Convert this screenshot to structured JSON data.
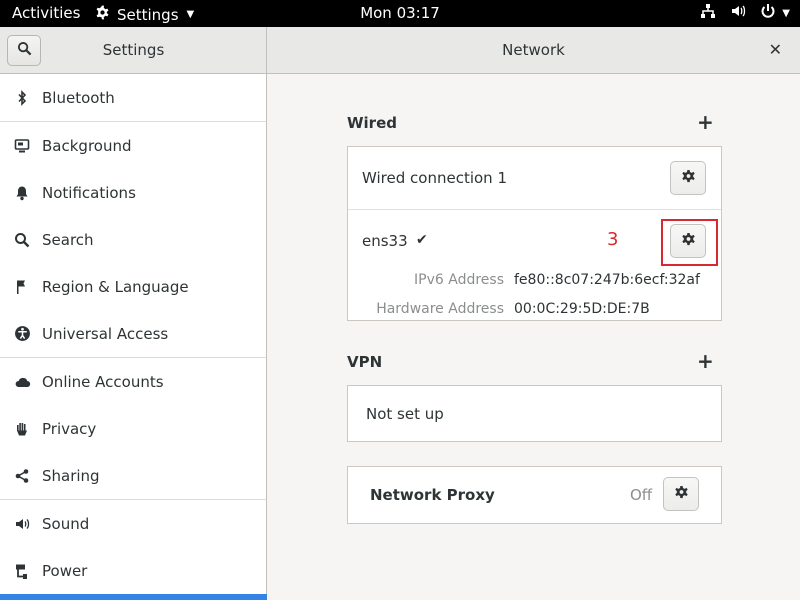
{
  "topbar": {
    "activities": "Activities",
    "app_name": "Settings",
    "clock": "Mon 03:17"
  },
  "headerbar": {
    "left_title": "Settings",
    "right_title": "Network"
  },
  "sidebar": {
    "items": [
      {
        "label": "Bluetooth",
        "icon": "bluetooth-icon"
      },
      {
        "label": "Background",
        "icon": "background-icon"
      },
      {
        "label": "Notifications",
        "icon": "bell-icon"
      },
      {
        "label": "Search",
        "icon": "search-icon"
      },
      {
        "label": "Region & Language",
        "icon": "flag-icon"
      },
      {
        "label": "Universal Access",
        "icon": "accessibility-icon"
      },
      {
        "label": "Online Accounts",
        "icon": "cloud-icon"
      },
      {
        "label": "Privacy",
        "icon": "hand-icon"
      },
      {
        "label": "Sharing",
        "icon": "share-icon"
      },
      {
        "label": "Sound",
        "icon": "speaker-icon"
      },
      {
        "label": "Power",
        "icon": "power-plug-icon"
      }
    ],
    "selected_color": "#3584e4"
  },
  "wired": {
    "title": "Wired",
    "connection_name": "Wired connection 1",
    "device": "ens33",
    "ipv6_label": "IPv6 Address",
    "ipv6_value": "fe80::8c07:247b:6ecf:32af",
    "hw_label": "Hardware Address",
    "hw_value": "00:0C:29:5D:DE:7B",
    "annotation": "3"
  },
  "vpn": {
    "title": "VPN",
    "empty_text": "Not set up"
  },
  "proxy": {
    "title": "Network Proxy",
    "status": "Off"
  },
  "colors": {
    "accent": "#3584e4",
    "annotation": "#d9282f"
  }
}
